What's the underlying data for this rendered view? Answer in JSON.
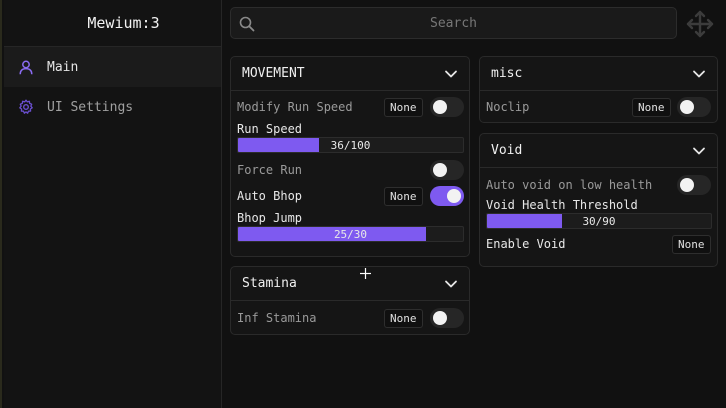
{
  "app": {
    "title": "Mewium:3"
  },
  "sidebar": {
    "items": [
      {
        "label": "Main",
        "icon": "user-icon"
      },
      {
        "label": "UI Settings",
        "icon": "gear-icon"
      }
    ]
  },
  "search": {
    "placeholder": "Search"
  },
  "colors": {
    "accent": "#7e5af0",
    "background": "#111111",
    "panel": "#151515"
  },
  "movement": {
    "title": "MOVEMENT",
    "modify_run_speed": {
      "label": "Modify Run Speed",
      "key": "None",
      "enabled": false
    },
    "run_speed": {
      "label": "Run Speed",
      "value": 36,
      "max": 100,
      "display": "36/100"
    },
    "force_run": {
      "label": "Force Run",
      "enabled": false
    },
    "auto_bhop": {
      "label": "Auto Bhop",
      "key": "None",
      "enabled": true
    },
    "bhop_jump": {
      "label": "Bhop Jump",
      "value": 25,
      "max": 30,
      "display": "25/30"
    }
  },
  "stamina": {
    "title": "Stamina",
    "inf_stamina": {
      "label": "Inf Stamina",
      "key": "None",
      "enabled": false
    }
  },
  "misc": {
    "title": "misc",
    "noclip": {
      "label": "Noclip",
      "key": "None",
      "enabled": false
    }
  },
  "void": {
    "title": "Void",
    "auto_void": {
      "label": "Auto void on low health",
      "enabled": false
    },
    "threshold": {
      "label": "Void Health Threshold",
      "value": 30,
      "max": 90,
      "display": "30/90"
    },
    "enable_void": {
      "label": "Enable Void",
      "key": "None"
    }
  }
}
